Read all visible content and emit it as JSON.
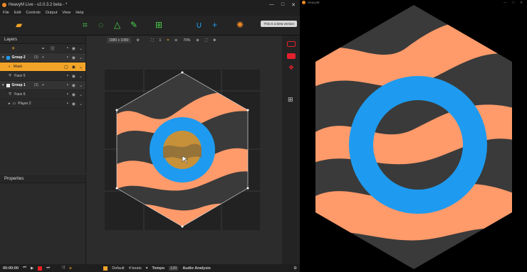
{
  "main_window": {
    "title": "HeavyM Live - v2.0.3.2 beta - *",
    "controls": {
      "minimize": "—",
      "maximize": "□",
      "close": "✕"
    }
  },
  "menu": [
    "File",
    "Edit",
    "Controls",
    "Output",
    "View",
    "Help"
  ],
  "toolbar": {
    "beta_label": "This is a beta version",
    "resolution": "1080 x 1080",
    "zoom": "70%",
    "count": "1"
  },
  "layers_panel": {
    "title": "Layers",
    "rows": [
      {
        "label": "Group 2",
        "count": "(3)"
      },
      {
        "label": "Mask"
      },
      {
        "label": "Face 5"
      },
      {
        "label": "Group 1",
        "count": "(3)"
      },
      {
        "label": "Face 6"
      },
      {
        "label": "Player 2"
      }
    ]
  },
  "properties_panel": {
    "title": "Properties"
  },
  "bottom_bar": {
    "time": "00:00:00",
    "preset": "Default",
    "beats": "4 beats",
    "tempo_label": "Tempo",
    "tempo_value": "120",
    "audio_label": "Audio Analysis"
  },
  "second_window": {
    "title": "HeavyM",
    "controls": {
      "minimize": "—",
      "maximize": "□",
      "close": "✕"
    }
  },
  "colors": {
    "accent_orange": "#f2a428",
    "ring_blue": "#1e9bf0",
    "shape_salmon": "#ff9a6a",
    "shape_dark": "#3a3a3a",
    "record_red": "#e5202e"
  }
}
